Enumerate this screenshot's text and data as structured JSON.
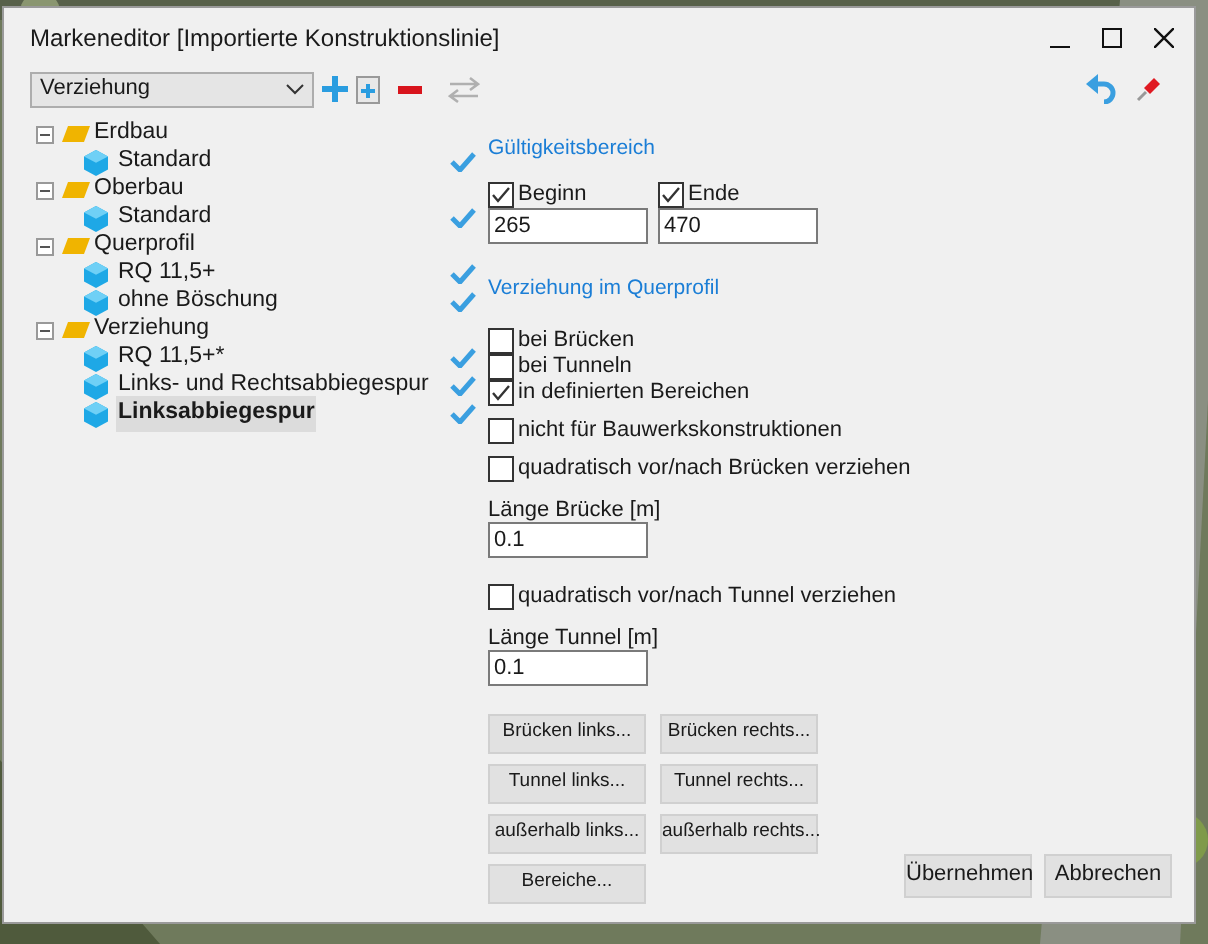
{
  "window": {
    "title": "Markeneditor [Importierte Konstruktionslinie]"
  },
  "toolbar": {
    "dropdown": {
      "value": "Verziehung"
    }
  },
  "tree": [
    {
      "label": "Erdbau",
      "expanded": true,
      "children": [
        {
          "label": "Standard",
          "valid": true,
          "selected": false
        }
      ]
    },
    {
      "label": "Oberbau",
      "expanded": true,
      "children": [
        {
          "label": "Standard",
          "valid": true,
          "selected": false
        }
      ]
    },
    {
      "label": "Querprofil",
      "expanded": true,
      "children": [
        {
          "label": "RQ 11,5+",
          "valid": true,
          "selected": false
        },
        {
          "label": "ohne Böschung",
          "valid": true,
          "selected": false
        }
      ]
    },
    {
      "label": "Verziehung",
      "expanded": true,
      "children": [
        {
          "label": "RQ 11,5+*",
          "valid": true,
          "selected": false
        },
        {
          "label": "Links- und Rechtsabbiegespur",
          "valid": true,
          "selected": false
        },
        {
          "label": "Linksabbiegespur",
          "valid": true,
          "selected": true
        }
      ]
    }
  ],
  "validity": {
    "heading": "Gültigkeitsbereich",
    "fields": [
      {
        "label": "Beginn",
        "checked": true,
        "value": "265"
      },
      {
        "label": "Ende",
        "checked": true,
        "value": "470"
      }
    ]
  },
  "profile": {
    "heading": "Verziehung im Querprofil",
    "items": [
      {
        "kind": "group",
        "options": [
          {
            "label": "bei Brücken",
            "checked": false
          },
          {
            "label": "bei Tunneln",
            "checked": false
          },
          {
            "label": "in definierten Bereichen",
            "checked": true
          }
        ]
      },
      {
        "kind": "checkbox",
        "label": "nicht für Bauwerkskonstruktionen",
        "checked": false
      },
      {
        "kind": "checkbox",
        "label": "quadratisch vor/nach Brücken verziehen",
        "checked": false
      },
      {
        "kind": "field",
        "label": "Länge Brücke [m]",
        "value": "0.1"
      },
      {
        "kind": "checkbox",
        "label": "quadratisch vor/nach Tunnel verziehen",
        "checked": false
      },
      {
        "kind": "field",
        "label": "Länge Tunnel [m]",
        "value": "0.1"
      },
      {
        "kind": "buttons",
        "buttons": [
          "Brücken links...",
          "Brücken rechts..."
        ]
      },
      {
        "kind": "buttons",
        "buttons": [
          "Tunnel links...",
          "Tunnel rechts..."
        ]
      },
      {
        "kind": "buttons",
        "buttons": [
          "außerhalb links...",
          "außerhalb rechts..."
        ]
      },
      {
        "kind": "buttons",
        "buttons": [
          "Bereiche..."
        ]
      }
    ]
  },
  "footer": {
    "buttons": [
      "Übernehmen",
      "Abbrechen"
    ]
  }
}
